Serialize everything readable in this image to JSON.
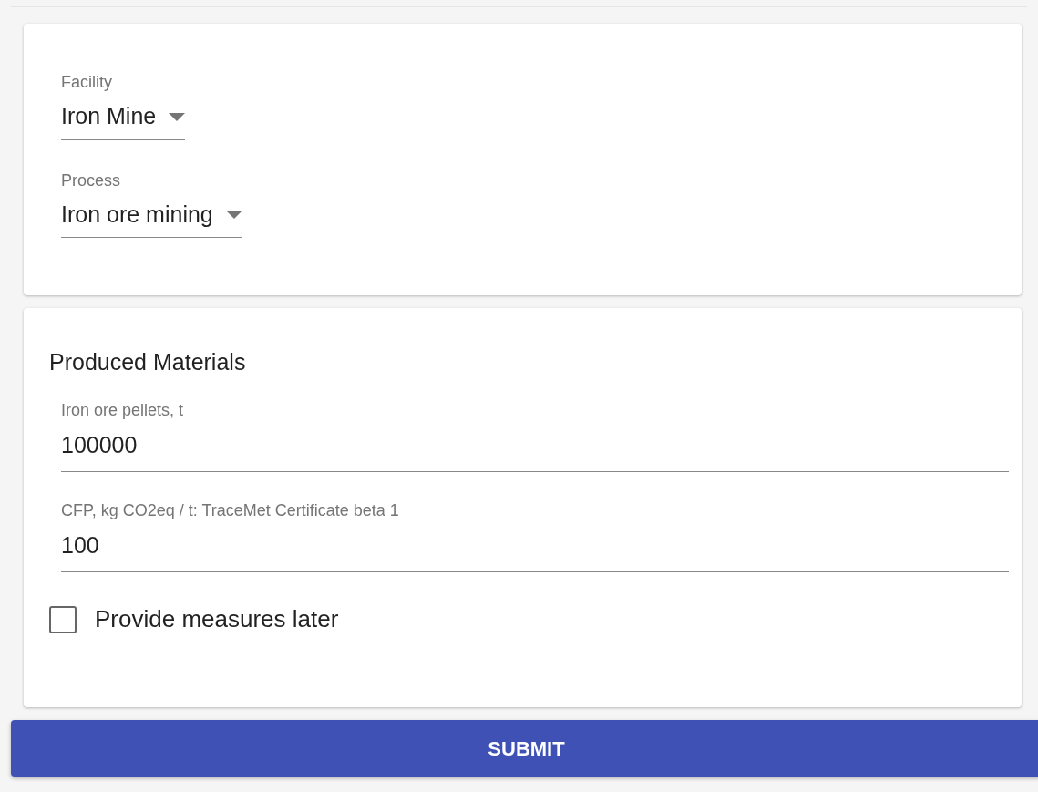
{
  "selects": [
    {
      "label": "Facility",
      "value": "Iron Mine"
    },
    {
      "label": "Process",
      "value": "Iron ore mining"
    }
  ],
  "produced": {
    "title": "Produced Materials",
    "fields": [
      {
        "label": "Iron ore pellets, t",
        "value": "100000"
      },
      {
        "label": "CFP, kg CO2eq / t: TraceMet Certificate beta 1",
        "value": "100"
      }
    ],
    "checkbox": {
      "label": "Provide measures later",
      "checked": false
    }
  },
  "submit": "SUBMIT"
}
